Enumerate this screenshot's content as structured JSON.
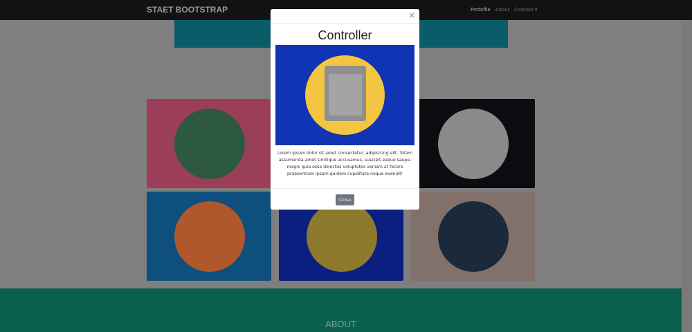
{
  "navbar": {
    "brand": "STAET BOOTSTRAP",
    "links": [
      "Protofile",
      "About",
      "Contact ▾"
    ]
  },
  "cards": [
    {
      "name": "cabin",
      "bg": "#9b3e5a",
      "circle": "#2d5a3e"
    },
    {
      "name": "placeholder",
      "bg": "#7f7f7f",
      "circle": "#7f7f7f"
    },
    {
      "name": "circus",
      "bg": "#0c0b10",
      "circle": "#8a8a8a"
    },
    {
      "name": "controller",
      "bg": "#0f4f7e",
      "circle": "#b0582b"
    },
    {
      "name": "safe",
      "bg": "#0b1f80",
      "circle": "#8e7a2c"
    },
    {
      "name": "submarine",
      "bg": "#82716a",
      "circle": "#1a2a3a"
    }
  ],
  "about": {
    "heading": "ABOUT"
  },
  "modal": {
    "title": "Controller",
    "body": "Lorem ipsum dolor sit amet consectetur, adipisicing elit. Totam assumenda amet similique accusamus, suscipit eaque saepe, magni quia esse delectus voluptates veniam at facere praesentium ipsam quidem cupiditate neque eveniet!",
    "close_label": "Close",
    "close_icon": "×"
  }
}
